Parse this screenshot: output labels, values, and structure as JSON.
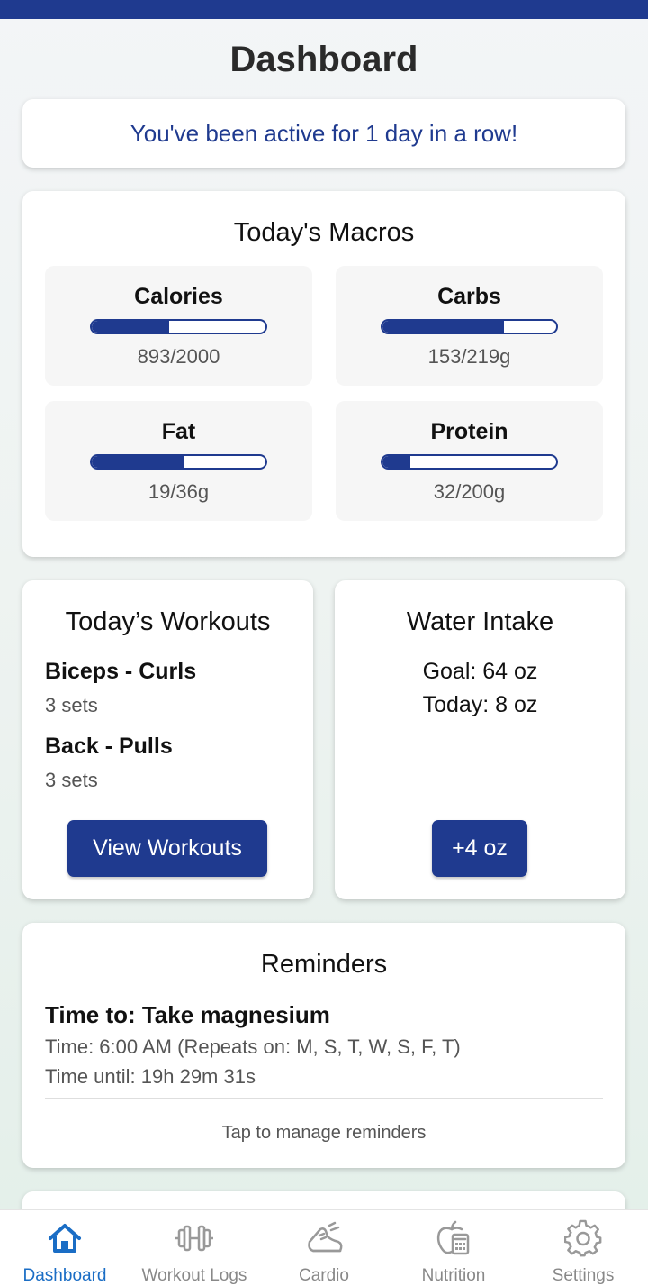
{
  "header": {
    "title": "Dashboard"
  },
  "streak": {
    "text": "You've been active for 1 day in a row!"
  },
  "macros": {
    "title": "Today's Macros",
    "items": [
      {
        "name": "Calories",
        "value": "893/2000",
        "progress": 0.4465
      },
      {
        "name": "Carbs",
        "value": "153/219g",
        "progress": 0.6986
      },
      {
        "name": "Fat",
        "value": "19/36g",
        "progress": 0.5278
      },
      {
        "name": "Protein",
        "value": "32/200g",
        "progress": 0.16
      }
    ]
  },
  "workouts": {
    "title": "Today’s Workouts",
    "items": [
      {
        "name": "Biceps - Curls",
        "sets": "3 sets"
      },
      {
        "name": "Back - Pulls",
        "sets": "3 sets"
      }
    ],
    "button_label": "View Workouts"
  },
  "water": {
    "title": "Water Intake",
    "goal": "Goal: 64 oz",
    "today": "Today: 8 oz",
    "button_label": "+4 oz"
  },
  "reminders": {
    "title": "Reminders",
    "item": {
      "heading": "Time to: Take magnesium",
      "time": "Time: 6:00 AM (Repeats on: M, S, T, W, S, F, T)",
      "until": "Time until: 19h 29m 31s"
    },
    "manage_label": "Tap to manage reminders"
  },
  "nav": {
    "items": [
      {
        "label": "Dashboard",
        "icon": "home-icon",
        "active": true
      },
      {
        "label": "Workout Logs",
        "icon": "dumbbell-icon",
        "active": false
      },
      {
        "label": "Cardio",
        "icon": "running-shoe-icon",
        "active": false
      },
      {
        "label": "Nutrition",
        "icon": "apple-calculator-icon",
        "active": false
      },
      {
        "label": "Settings",
        "icon": "gear-icon",
        "active": false
      }
    ]
  },
  "colors": {
    "accent": "#1f3a8f",
    "active_nav": "#1a6dc5",
    "inactive_nav": "#888888"
  }
}
